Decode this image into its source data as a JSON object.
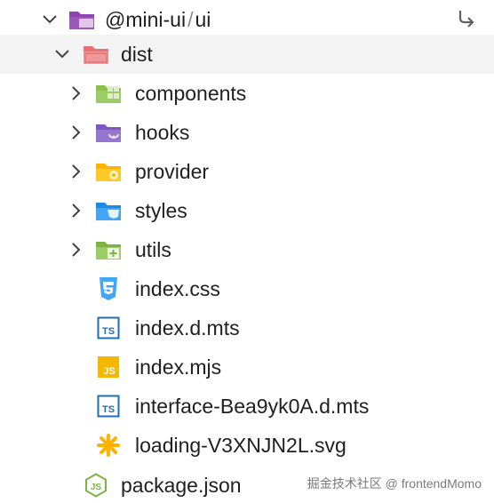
{
  "root": {
    "name": "@mini-ui",
    "sep": "/",
    "sub": "ui"
  },
  "dist": {
    "name": "dist"
  },
  "folders": [
    {
      "name": "components",
      "icon": "components-folder-icon"
    },
    {
      "name": "hooks",
      "icon": "hooks-folder-icon"
    },
    {
      "name": "provider",
      "icon": "provider-folder-icon"
    },
    {
      "name": "styles",
      "icon": "styles-folder-icon"
    },
    {
      "name": "utils",
      "icon": "utils-folder-icon"
    }
  ],
  "files": [
    {
      "name": "index.css",
      "icon": "css-file-icon"
    },
    {
      "name": "index.d.mts",
      "icon": "typescript-file-icon"
    },
    {
      "name": "index.mjs",
      "icon": "javascript-file-icon"
    },
    {
      "name": "interface-Bea9yk0A.d.mts",
      "icon": "typescript-file-icon"
    },
    {
      "name": "loading-V3XNJN2L.svg",
      "icon": "svg-file-icon"
    }
  ],
  "package": {
    "name": "package.json",
    "icon": "nodejs-file-icon"
  },
  "watermark": "掘金技术社区 @ frontendMomo",
  "colors": {
    "folder_purple": "#8e44ad",
    "folder_red": "#e57373",
    "folder_green": "#8bc34a",
    "folder_yellow": "#ffc107",
    "folder_blue": "#42a5f5",
    "ts_blue": "#1e6fb5",
    "js_yellow": "#f5b800",
    "svg_orange": "#ffb300",
    "node_green": "#7cb342"
  }
}
